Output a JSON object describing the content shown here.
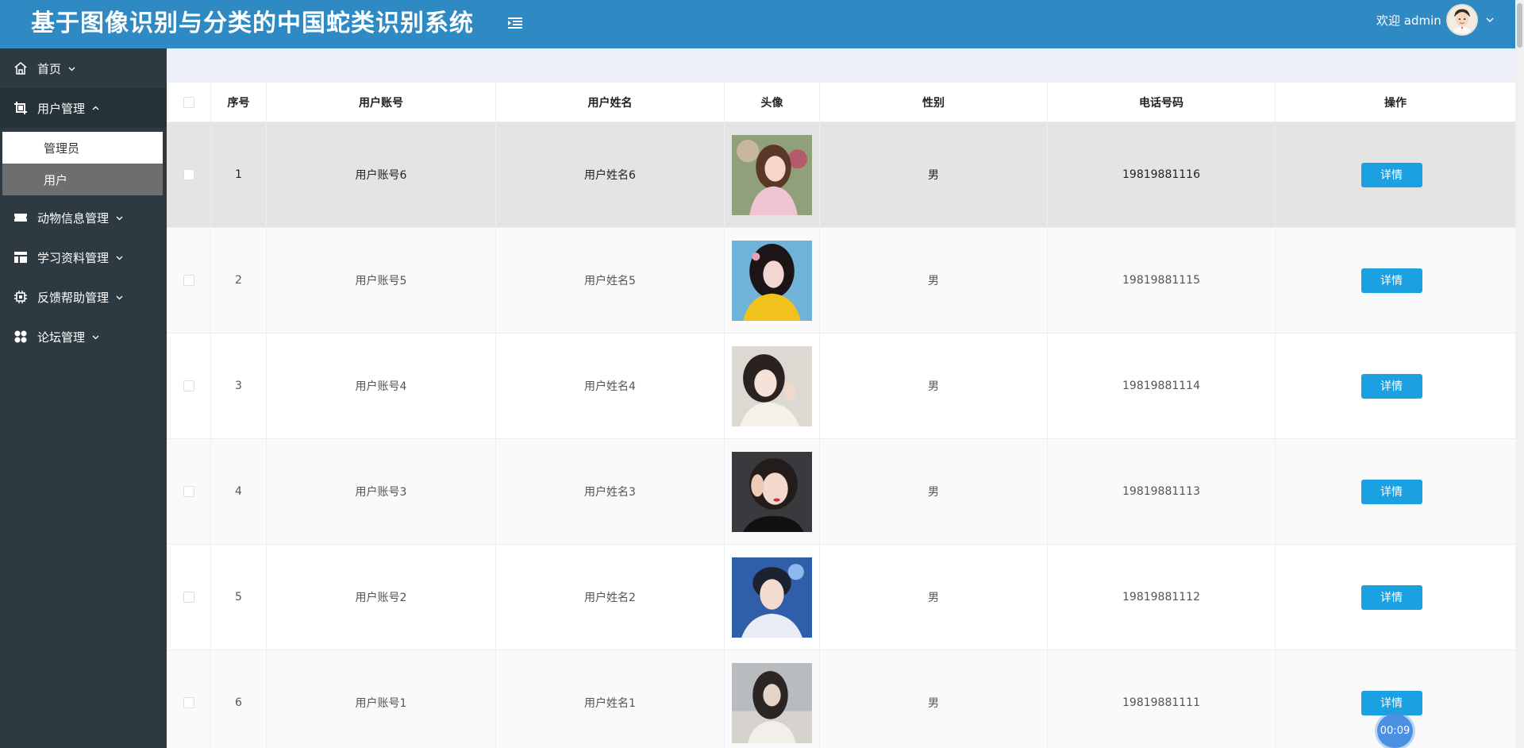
{
  "header": {
    "title": "基于图像识别与分类的中国蛇类识别系统",
    "welcome": "欢迎 admin"
  },
  "sidebar": {
    "items": [
      {
        "label": "首页",
        "icon": "home-icon",
        "chevron": "down"
      },
      {
        "label": "用户管理",
        "icon": "crop-icon",
        "chevron": "up"
      },
      {
        "label": "动物信息管理",
        "icon": "ticket-icon",
        "chevron": "down"
      },
      {
        "label": "学习资料管理",
        "icon": "layout-icon",
        "chevron": "down"
      },
      {
        "label": "反馈帮助管理",
        "icon": "chip-icon",
        "chevron": "down"
      },
      {
        "label": "论坛管理",
        "icon": "apps-icon",
        "chevron": "down"
      }
    ],
    "submenu": [
      {
        "label": "管理员"
      },
      {
        "label": "用户"
      }
    ]
  },
  "table": {
    "headers": [
      "序号",
      "用户账号",
      "用户姓名",
      "头像",
      "性别",
      "电话号码",
      "操作"
    ],
    "rows": [
      {
        "index": "1",
        "account": "用户账号6",
        "name": "用户姓名6",
        "gender": "男",
        "phone": "19819881116",
        "action": "详情"
      },
      {
        "index": "2",
        "account": "用户账号5",
        "name": "用户姓名5",
        "gender": "男",
        "phone": "19819881115",
        "action": "详情"
      },
      {
        "index": "3",
        "account": "用户账号4",
        "name": "用户姓名4",
        "gender": "男",
        "phone": "19819881114",
        "action": "详情"
      },
      {
        "index": "4",
        "account": "用户账号3",
        "name": "用户姓名3",
        "gender": "男",
        "phone": "19819881113",
        "action": "详情"
      },
      {
        "index": "5",
        "account": "用户账号2",
        "name": "用户姓名2",
        "gender": "男",
        "phone": "19819881112",
        "action": "详情"
      },
      {
        "index": "6",
        "account": "用户账号1",
        "name": "用户姓名1",
        "gender": "男",
        "phone": "19819881111",
        "action": "详情"
      }
    ]
  },
  "timer": "00:09",
  "colors": {
    "header": "#2f8ac4",
    "sidebar": "#2d3a42",
    "button": "#1ba1e2"
  }
}
